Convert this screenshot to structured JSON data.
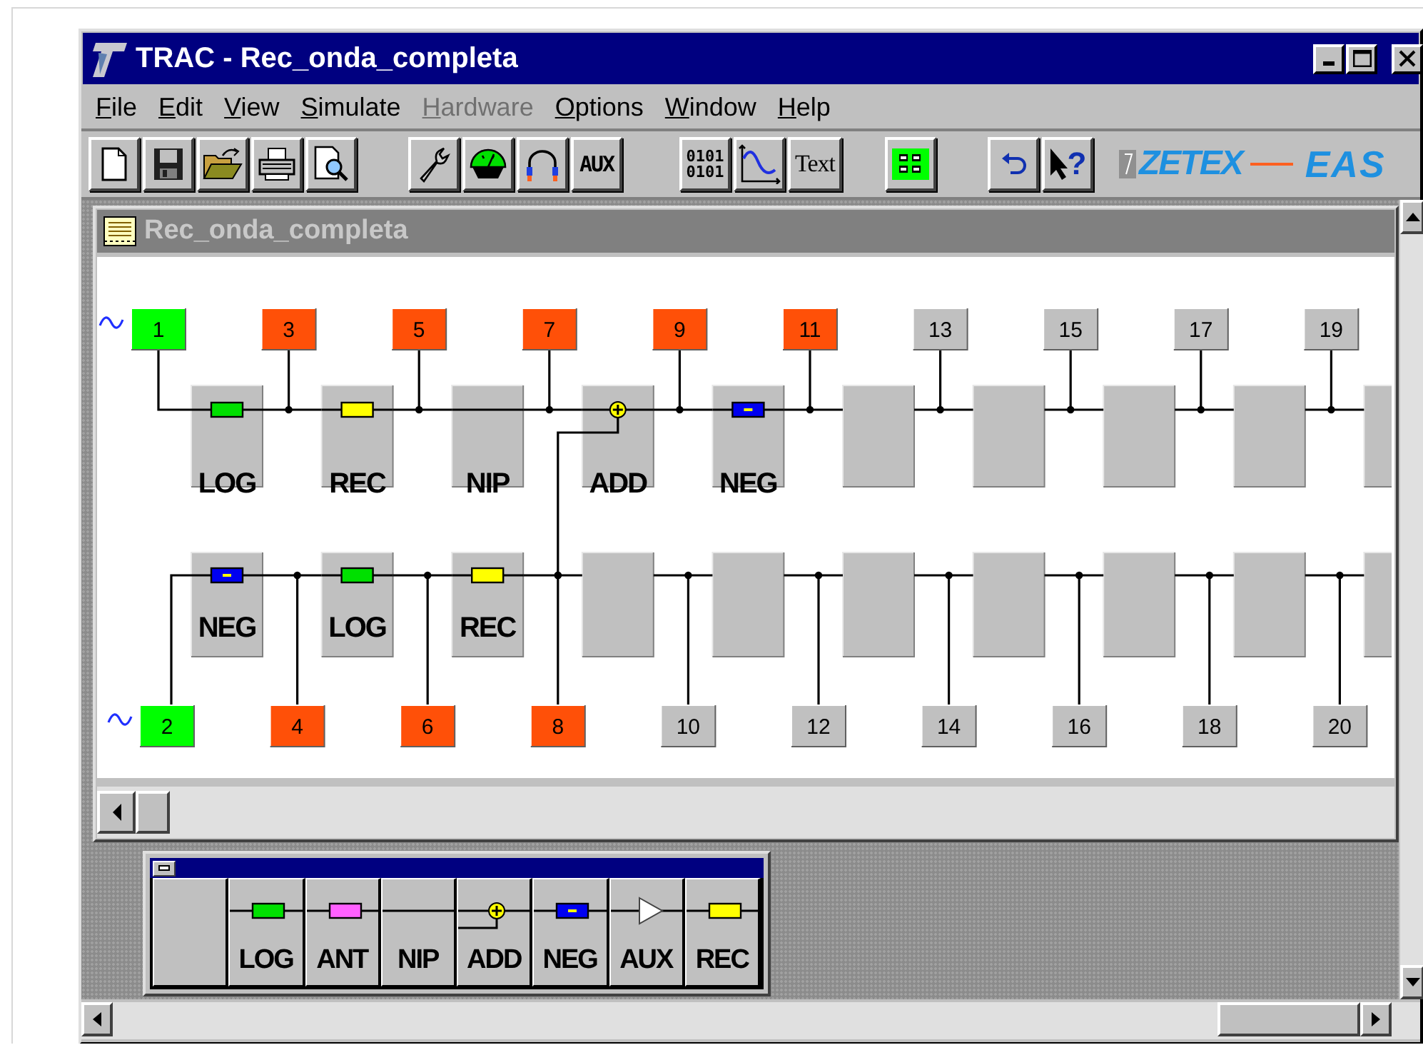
{
  "window": {
    "title": "TRAC - Rec_onda_completa"
  },
  "menu": [
    {
      "label": "File",
      "disabled": false
    },
    {
      "label": "Edit",
      "disabled": false
    },
    {
      "label": "View",
      "disabled": false
    },
    {
      "label": "Simulate",
      "disabled": false
    },
    {
      "label": "Hardware",
      "disabled": true
    },
    {
      "label": "Options",
      "disabled": false
    },
    {
      "label": "Window",
      "disabled": false
    },
    {
      "label": "Help",
      "disabled": false
    }
  ],
  "toolbar": [
    [
      {
        "kind": "new"
      },
      {
        "kind": "save"
      },
      {
        "kind": "open"
      },
      {
        "kind": "print"
      },
      {
        "kind": "preview"
      }
    ],
    [
      {
        "kind": "wrench"
      },
      {
        "kind": "meter"
      },
      {
        "kind": "cable"
      },
      {
        "kind": "caption",
        "label": "AUX"
      }
    ],
    [
      {
        "kind": "binary",
        "lines": [
          "0101",
          "0101"
        ]
      },
      {
        "kind": "wave"
      },
      {
        "kind": "text",
        "label": "Text"
      }
    ],
    [
      {
        "kind": "grid"
      }
    ],
    [
      {
        "kind": "undo"
      },
      {
        "kind": "help",
        "label": "?"
      }
    ]
  ],
  "logos": [
    "ZETEX",
    "EAS"
  ],
  "document": {
    "title": "Rec_onda_completa",
    "diagram": {
      "rows": [
        {
          "nodes": [
            {
              "label": "1",
              "color": "#00ff00",
              "source": true
            },
            {
              "label": "3",
              "color": "#ff5008",
              "source": false
            },
            {
              "label": "5",
              "color": "#ff5008",
              "source": false
            },
            {
              "label": "7",
              "color": "#ff5008",
              "source": false
            },
            {
              "label": "9",
              "color": "#ff5008",
              "source": false
            },
            {
              "label": "11",
              "color": "#ff5008",
              "source": false
            },
            {
              "label": "13",
              "color": "#c0c0c0",
              "source": false
            },
            {
              "label": "15",
              "color": "#c0c0c0",
              "source": false
            },
            {
              "label": "17",
              "color": "#c0c0c0",
              "source": false
            },
            {
              "label": "19",
              "color": "#c0c0c0",
              "source": false
            }
          ],
          "blocks": [
            {
              "kind": "log",
              "label": "LOG"
            },
            {
              "kind": "rec",
              "label": "REC"
            },
            {
              "kind": "nip",
              "label": "NIP"
            },
            {
              "kind": "add",
              "label": "ADD"
            },
            {
              "kind": "neg",
              "label": "NEG"
            },
            {
              "kind": "empty"
            },
            {
              "kind": "empty"
            },
            {
              "kind": "empty"
            },
            {
              "kind": "empty"
            },
            {
              "kind": "empty"
            }
          ]
        },
        {
          "nodes": [
            {
              "label": "2",
              "color": "#00ff00",
              "source": true
            },
            {
              "label": "4",
              "color": "#ff5008",
              "source": false
            },
            {
              "label": "6",
              "color": "#ff5008",
              "source": false
            },
            {
              "label": "8",
              "color": "#ff5008",
              "source": false
            },
            {
              "label": "10",
              "color": "#c0c0c0",
              "source": false
            },
            {
              "label": "12",
              "color": "#c0c0c0",
              "source": false
            },
            {
              "label": "14",
              "color": "#c0c0c0",
              "source": false
            },
            {
              "label": "16",
              "color": "#c0c0c0",
              "source": false
            },
            {
              "label": "18",
              "color": "#c0c0c0",
              "source": false
            },
            {
              "label": "20",
              "color": "#c0c0c0",
              "source": false
            }
          ],
          "blocks": [
            {
              "kind": "neg",
              "label": "NEG"
            },
            {
              "kind": "log",
              "label": "LOG"
            },
            {
              "kind": "rec",
              "label": "REC"
            },
            {
              "kind": "empty"
            },
            {
              "kind": "empty"
            },
            {
              "kind": "empty"
            },
            {
              "kind": "empty"
            },
            {
              "kind": "empty"
            },
            {
              "kind": "empty"
            },
            {
              "kind": "empty"
            }
          ]
        }
      ]
    }
  },
  "palette": {
    "blocks": [
      {
        "kind": "empty"
      },
      {
        "kind": "log",
        "label": "LOG"
      },
      {
        "kind": "ant",
        "label": "ANT"
      },
      {
        "kind": "nip",
        "label": "NIP"
      },
      {
        "kind": "add",
        "label": "ADD"
      },
      {
        "kind": "neg",
        "label": "NEG"
      },
      {
        "kind": "aux",
        "label": "AUX"
      },
      {
        "kind": "rec",
        "label": "REC"
      }
    ]
  }
}
